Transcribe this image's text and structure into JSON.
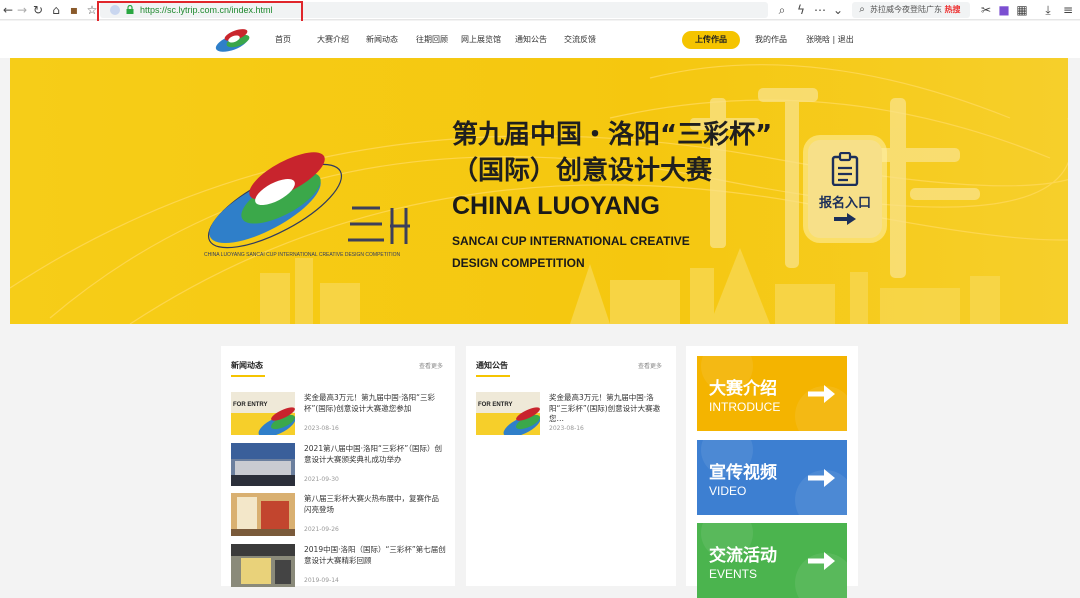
{
  "browser": {
    "url": "https://sc.lytrip.com.cn/index.html",
    "search_text": "苏拉威今夜登陆广东",
    "hot_badge": "热搜"
  },
  "nav": {
    "items": [
      "首页",
      "大赛介绍",
      "新闻动态",
      "往期回顾",
      "网上展览馆",
      "通知公告",
      "交流反馈"
    ],
    "upload_label": "上传作品",
    "my_works": "我的作品",
    "user": "张晓晗 | 退出"
  },
  "banner": {
    "title_line1": "第九届中国・洛阳“三彩杯”",
    "title_line2": "（国际）创意设计大赛",
    "en_line1": "CHINA LUOYANG",
    "en_line2": "SANCAI CUP INTERNATIONAL CREATIVE",
    "en_line3": "DESIGN COMPETITION",
    "logo_caption": "CHINA LUOYANG SANCAI CUP INTERNATIONAL CREATIVE DESIGN COMPETITION",
    "register_label": "报名入口"
  },
  "news": {
    "title": "新闻动态",
    "more": "查看更多",
    "items": [
      {
        "text": "奖金最高3万元！第九届中国·洛阳“三彩杯”(国际)创意设计大赛邀您参加",
        "date": "2023-08-16",
        "thumb_text": "FOR ENTRY"
      },
      {
        "text": "2021第八届中国·洛阳“三彩杯”（国际）创意设计大赛颁奖典礼成功举办",
        "date": "2021-09-30"
      },
      {
        "text": "第八届三彩杯大赛火热布展中，复赛作品闪亮登场",
        "date": "2021-09-26"
      },
      {
        "text": "2019中国·洛阳（国际）“三彩杯”第七届创意设计大赛精彩回顾",
        "date": "2019-09-14"
      }
    ]
  },
  "notice": {
    "title": "通知公告",
    "more": "查看更多",
    "items": [
      {
        "text": "奖金最高3万元！第九届中国·洛阳“三彩杯”(国际)创意设计大赛邀您…",
        "date": "2023-08-16",
        "thumb_text": "FOR ENTRY"
      }
    ]
  },
  "tiles": [
    {
      "cn": "大赛介绍",
      "en": "INTRODUCE",
      "color": "#f4b400"
    },
    {
      "cn": "宣传视频",
      "en": "VIDEO",
      "color": "#3d7fd1"
    },
    {
      "cn": "交流活动",
      "en": "EVENTS",
      "color": "#4bb44e"
    }
  ]
}
